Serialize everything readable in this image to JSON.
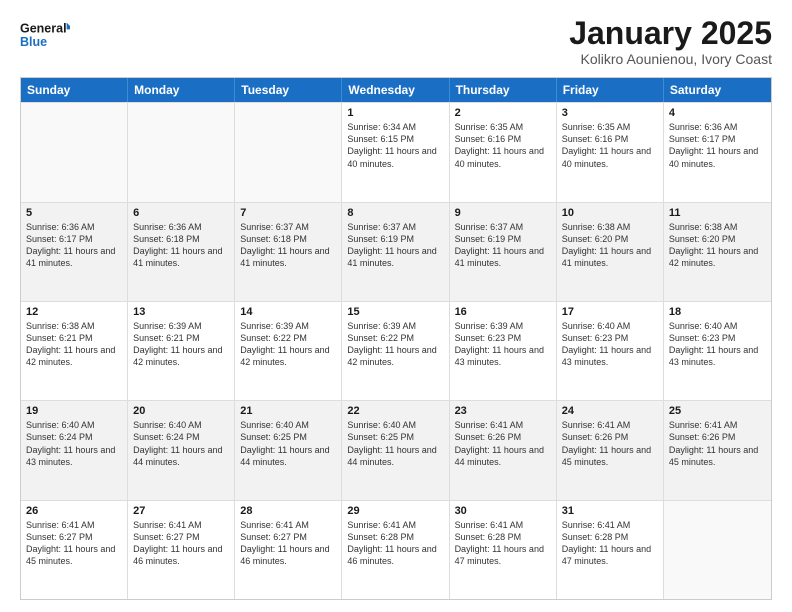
{
  "logo": {
    "line1": "General",
    "line2": "Blue"
  },
  "title": "January 2025",
  "location": "Kolikro Aounienou, Ivory Coast",
  "days": [
    "Sunday",
    "Monday",
    "Tuesday",
    "Wednesday",
    "Thursday",
    "Friday",
    "Saturday"
  ],
  "rows": [
    [
      {
        "day": "",
        "empty": true
      },
      {
        "day": "",
        "empty": true
      },
      {
        "day": "",
        "empty": true
      },
      {
        "day": "1",
        "sunrise": "6:34 AM",
        "sunset": "6:15 PM",
        "daylight": "11 hours and 40 minutes."
      },
      {
        "day": "2",
        "sunrise": "6:35 AM",
        "sunset": "6:16 PM",
        "daylight": "11 hours and 40 minutes."
      },
      {
        "day": "3",
        "sunrise": "6:35 AM",
        "sunset": "6:16 PM",
        "daylight": "11 hours and 40 minutes."
      },
      {
        "day": "4",
        "sunrise": "6:36 AM",
        "sunset": "6:17 PM",
        "daylight": "11 hours and 40 minutes."
      }
    ],
    [
      {
        "day": "5",
        "sunrise": "6:36 AM",
        "sunset": "6:17 PM",
        "daylight": "11 hours and 41 minutes."
      },
      {
        "day": "6",
        "sunrise": "6:36 AM",
        "sunset": "6:18 PM",
        "daylight": "11 hours and 41 minutes."
      },
      {
        "day": "7",
        "sunrise": "6:37 AM",
        "sunset": "6:18 PM",
        "daylight": "11 hours and 41 minutes."
      },
      {
        "day": "8",
        "sunrise": "6:37 AM",
        "sunset": "6:19 PM",
        "daylight": "11 hours and 41 minutes."
      },
      {
        "day": "9",
        "sunrise": "6:37 AM",
        "sunset": "6:19 PM",
        "daylight": "11 hours and 41 minutes."
      },
      {
        "day": "10",
        "sunrise": "6:38 AM",
        "sunset": "6:20 PM",
        "daylight": "11 hours and 41 minutes."
      },
      {
        "day": "11",
        "sunrise": "6:38 AM",
        "sunset": "6:20 PM",
        "daylight": "11 hours and 42 minutes."
      }
    ],
    [
      {
        "day": "12",
        "sunrise": "6:38 AM",
        "sunset": "6:21 PM",
        "daylight": "11 hours and 42 minutes."
      },
      {
        "day": "13",
        "sunrise": "6:39 AM",
        "sunset": "6:21 PM",
        "daylight": "11 hours and 42 minutes."
      },
      {
        "day": "14",
        "sunrise": "6:39 AM",
        "sunset": "6:22 PM",
        "daylight": "11 hours and 42 minutes."
      },
      {
        "day": "15",
        "sunrise": "6:39 AM",
        "sunset": "6:22 PM",
        "daylight": "11 hours and 42 minutes."
      },
      {
        "day": "16",
        "sunrise": "6:39 AM",
        "sunset": "6:23 PM",
        "daylight": "11 hours and 43 minutes."
      },
      {
        "day": "17",
        "sunrise": "6:40 AM",
        "sunset": "6:23 PM",
        "daylight": "11 hours and 43 minutes."
      },
      {
        "day": "18",
        "sunrise": "6:40 AM",
        "sunset": "6:23 PM",
        "daylight": "11 hours and 43 minutes."
      }
    ],
    [
      {
        "day": "19",
        "sunrise": "6:40 AM",
        "sunset": "6:24 PM",
        "daylight": "11 hours and 43 minutes."
      },
      {
        "day": "20",
        "sunrise": "6:40 AM",
        "sunset": "6:24 PM",
        "daylight": "11 hours and 44 minutes."
      },
      {
        "day": "21",
        "sunrise": "6:40 AM",
        "sunset": "6:25 PM",
        "daylight": "11 hours and 44 minutes."
      },
      {
        "day": "22",
        "sunrise": "6:40 AM",
        "sunset": "6:25 PM",
        "daylight": "11 hours and 44 minutes."
      },
      {
        "day": "23",
        "sunrise": "6:41 AM",
        "sunset": "6:26 PM",
        "daylight": "11 hours and 44 minutes."
      },
      {
        "day": "24",
        "sunrise": "6:41 AM",
        "sunset": "6:26 PM",
        "daylight": "11 hours and 45 minutes."
      },
      {
        "day": "25",
        "sunrise": "6:41 AM",
        "sunset": "6:26 PM",
        "daylight": "11 hours and 45 minutes."
      }
    ],
    [
      {
        "day": "26",
        "sunrise": "6:41 AM",
        "sunset": "6:27 PM",
        "daylight": "11 hours and 45 minutes."
      },
      {
        "day": "27",
        "sunrise": "6:41 AM",
        "sunset": "6:27 PM",
        "daylight": "11 hours and 46 minutes."
      },
      {
        "day": "28",
        "sunrise": "6:41 AM",
        "sunset": "6:27 PM",
        "daylight": "11 hours and 46 minutes."
      },
      {
        "day": "29",
        "sunrise": "6:41 AM",
        "sunset": "6:28 PM",
        "daylight": "11 hours and 46 minutes."
      },
      {
        "day": "30",
        "sunrise": "6:41 AM",
        "sunset": "6:28 PM",
        "daylight": "11 hours and 47 minutes."
      },
      {
        "day": "31",
        "sunrise": "6:41 AM",
        "sunset": "6:28 PM",
        "daylight": "11 hours and 47 minutes."
      },
      {
        "day": "",
        "empty": true
      }
    ]
  ],
  "labels": {
    "sunrise_prefix": "Sunrise: ",
    "sunset_prefix": "Sunset: ",
    "daylight_prefix": "Daylight: "
  }
}
